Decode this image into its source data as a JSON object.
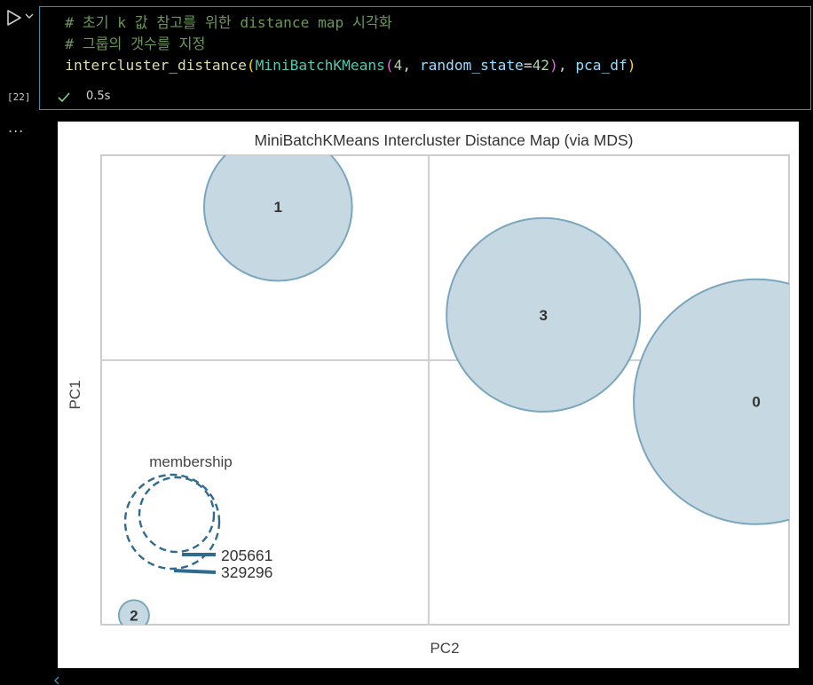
{
  "cell": {
    "execution_count": "[22]",
    "status_time": "0.5s",
    "code": {
      "comment1": "# 초기 k 값 참고를 위한 distance map 시각화",
      "comment2": "# 그룹의 갯수를 지정",
      "func": "intercluster_distance",
      "cls": "MiniBatchKMeans",
      "arg_k": "4",
      "param": "random_state",
      "arg_seed": "42",
      "arg_data": "pca_df"
    }
  },
  "output": {
    "menu_label": "..."
  },
  "chart_data": {
    "type": "scatter",
    "title": "MiniBatchKMeans Intercluster Distance Map (via MDS)",
    "xlabel": "PC2",
    "ylabel": "PC1",
    "xlim": [
      -1,
      1.1
    ],
    "ylim": [
      -1,
      1
    ],
    "grid": true,
    "points": [
      {
        "label": "0",
        "x": 1.0,
        "y": -0.05,
        "membership": 329296
      },
      {
        "label": "1",
        "x": -0.46,
        "y": 0.78,
        "membership": 120000
      },
      {
        "label": "2",
        "x": -0.9,
        "y": -0.96,
        "membership": 1500
      },
      {
        "label": "3",
        "x": 0.35,
        "y": 0.32,
        "membership": 205661
      }
    ],
    "legend": {
      "title": "membership",
      "placement": "lower-left",
      "values": [
        "205661",
        "329296"
      ]
    },
    "colors": {
      "bubble_fill": "#c6d9e3",
      "bubble_edge": "#7aa6be",
      "legend_stroke": "#2f6b8e"
    }
  }
}
